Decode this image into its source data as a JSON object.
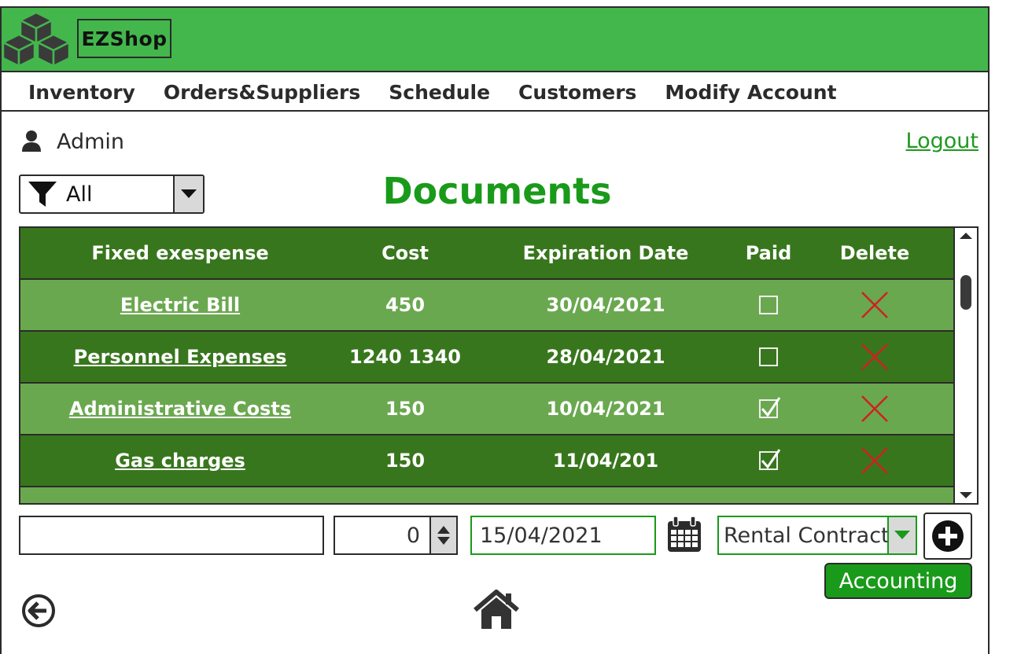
{
  "app": {
    "brand": "EZShop"
  },
  "nav": [
    {
      "label": "Inventory"
    },
    {
      "label": "Orders&Suppliers"
    },
    {
      "label": "Schedule"
    },
    {
      "label": "Customers"
    },
    {
      "label": "Modify Account"
    }
  ],
  "user": {
    "name": "Admin",
    "logout_label": "Logout"
  },
  "filter": {
    "value": "All"
  },
  "page": {
    "title": "Documents"
  },
  "table": {
    "headers": [
      "Fixed exespense",
      "Cost",
      "Expiration Date",
      "Paid",
      "Delete"
    ],
    "rows": [
      {
        "name": "Electric Bill",
        "cost": "450",
        "date": "30/04/2021",
        "paid": false
      },
      {
        "name": "Personnel Expenses",
        "cost": "1240 1340",
        "date": "28/04/2021",
        "paid": false
      },
      {
        "name": "Administrative Costs",
        "cost": "150",
        "date": "10/04/2021",
        "paid": true
      },
      {
        "name": "Gas charges",
        "cost": "150",
        "date": "11/04/201",
        "paid": true
      }
    ]
  },
  "form": {
    "name_value": "",
    "quantity_value": "0",
    "date_value": "15/04/2021",
    "type_value": "Rental Contract"
  },
  "actions": {
    "accounting_label": "Accounting"
  },
  "colors": {
    "header_green": "#43b74c",
    "row_light": "#6aa84f",
    "row_dark": "#38761d",
    "title_green": "#1a9a1a",
    "delete_red": "#cc2222"
  }
}
